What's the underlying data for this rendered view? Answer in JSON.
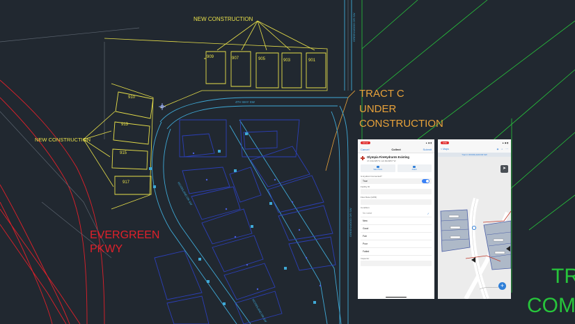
{
  "cad": {
    "labels": {
      "new_construction_top": "NEW CONSTRUCTION",
      "new_construction_left": "NEW CONSTRUCTION",
      "tract_c_line1": "TRACT C",
      "tract_c_line2": "UNDER",
      "tract_c_line3": "CONSTRUCTION",
      "evergreen_line1": "EVERGREEN",
      "evergreen_line2": "PKWY",
      "tr_partial_1": "TR",
      "tr_partial_2": "COM",
      "street_4th": "4TH WAY SW",
      "street_greenwood_top": "GREENWOOD DR SW",
      "street_greenwood_right": "GREENWOOD DR SW",
      "street_curve": "WOODLAND DR SW",
      "street_bottom": "WOODLAND DR SW"
    },
    "lots_top": [
      "909",
      "907",
      "905",
      "903",
      "901"
    ],
    "lots_left": [
      "910",
      "913",
      "915",
      "917"
    ],
    "colors": {
      "background": "#212830",
      "yellow": "#e8e04a",
      "orange": "#e8a23a",
      "red": "#e0202a",
      "blue": "#2c3fb8",
      "cyan": "#3fa9d6",
      "green": "#27c53b"
    }
  },
  "phone_collect": {
    "status_time": "10:12",
    "status_right": "▲ ◉ ▮",
    "nav_cancel": "Cancel",
    "nav_title": "Collect",
    "nav_submit": "Submit",
    "layer_title": "Olympia FireHydrants Existing",
    "coords": "47.0432485°N 122.8029857°W",
    "action_photo": "Take Photo",
    "action_attach": "Attach",
    "field_connected_label": "Is Hydrant Connected?",
    "field_connected_value": "True",
    "field_facility_label": "Facility ID",
    "field_flow_label": "Flow Rate (GPM)",
    "field_condition_label": "Condition",
    "condition_selected": "No value",
    "condition_options": [
      "New",
      "Good",
      "Fair",
      "Poor",
      "Failed"
    ],
    "field_inspector_label": "Inspector"
  },
  "phone_map": {
    "status_time": "9:59",
    "nav_back": "< Maps",
    "subtitle": "Tract C WOODLAND DR SW",
    "icon_layers": "layers-icon",
    "icon_search": "search-icon",
    "icon_more": "more-icon"
  }
}
